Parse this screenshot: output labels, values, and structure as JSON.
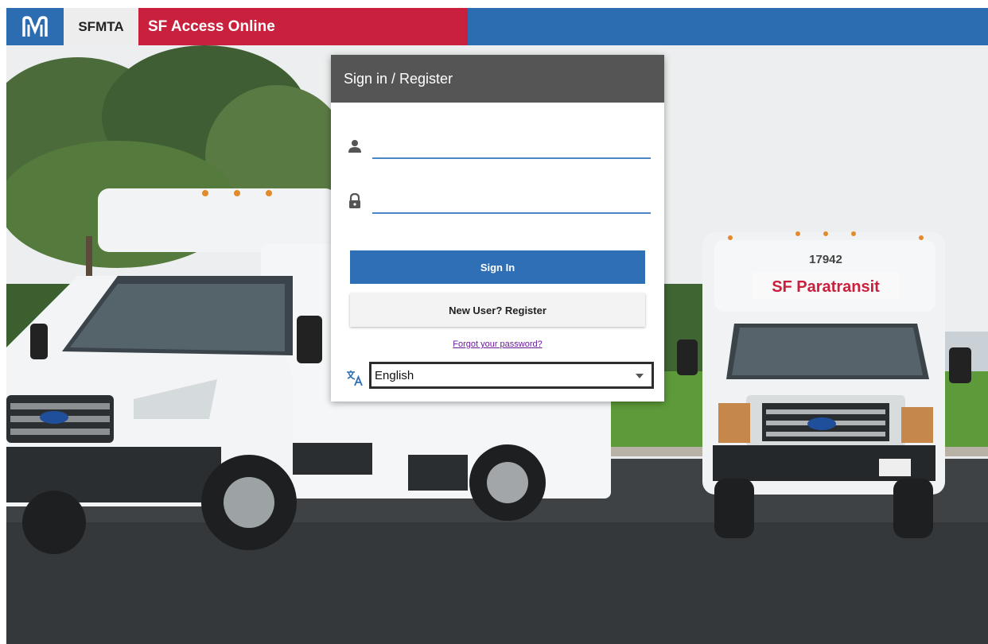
{
  "header": {
    "brand": "SFMTA",
    "title": "SF Access Online",
    "colors": {
      "blue": "#2c6db2",
      "red": "#c8203d"
    }
  },
  "background": {
    "rear_van_number": "17942",
    "rear_van_sign": "SF Paratransit"
  },
  "login_card": {
    "title": "Sign in / Register",
    "username": {
      "value": "",
      "placeholder": "",
      "icon": "person-icon"
    },
    "password": {
      "value": "",
      "placeholder": "",
      "icon": "lock-icon"
    },
    "sign_in_label": "Sign In",
    "register_label": "New User? Register",
    "forgot_label": "Forgot your password?",
    "language": {
      "icon": "translate-icon",
      "selected": "English"
    }
  }
}
